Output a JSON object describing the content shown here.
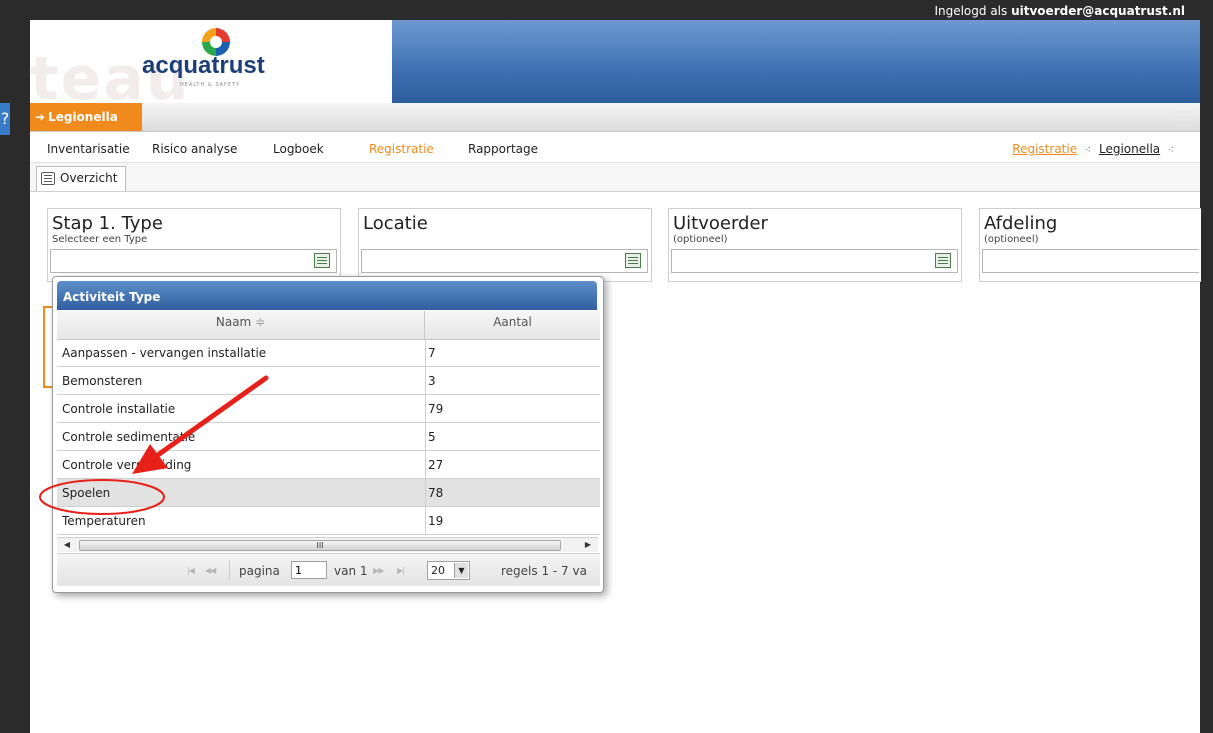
{
  "header": {
    "login_prefix": "Ingelogd als",
    "login_user": "uitvoerder@acquatrust.nl",
    "help_label": "?"
  },
  "logo": {
    "name": "acquatrust",
    "tagline": "HEALTH & SAFETY",
    "watermark": "teau"
  },
  "app": {
    "tab_label": "Legionella"
  },
  "nav": {
    "items": [
      "Inventarisatie",
      "Risico analyse",
      "Logboek",
      "Registratie",
      "Rapportage"
    ],
    "active": "Registratie"
  },
  "breadcrumb": {
    "items": [
      "Registratie",
      "Legionella"
    ]
  },
  "tabs": {
    "overzicht": "Overzicht"
  },
  "panels": [
    {
      "title": "Stap 1. Type",
      "subtitle": "Selecteer een Type",
      "value": ""
    },
    {
      "title": "Locatie",
      "subtitle": "",
      "value": ""
    },
    {
      "title": "Uitvoerder",
      "subtitle": "(optioneel)",
      "value": ""
    },
    {
      "title": "Afdeling",
      "subtitle": "(optioneel)",
      "value": ""
    }
  ],
  "grid": {
    "title": "Activiteit Type",
    "columns": [
      "Naam",
      "Aantal"
    ],
    "sort_indicator": "≑",
    "rows": [
      {
        "name": "Aanpassen - vervangen installatie",
        "count": "7"
      },
      {
        "name": "Bemonsteren",
        "count": "3"
      },
      {
        "name": "Controle installatie",
        "count": "79"
      },
      {
        "name": "Controle sedimentatie",
        "count": "5"
      },
      {
        "name": "Controle verspreiding",
        "count": "27"
      },
      {
        "name": "Spoelen",
        "count": "78"
      },
      {
        "name": "Temperaturen",
        "count": "19"
      }
    ],
    "selected_row": "Spoelen",
    "scroll_thumb": "III",
    "pager": {
      "page_label": "pagina",
      "page_value": "1",
      "of_label": "van 1",
      "page_size": "20",
      "records_label": "regels 1 - 7 va"
    }
  },
  "colors": {
    "accent_orange": "#f08a1c",
    "header_blue": "#3f70b3",
    "grid_title_blue": "#2f5f9f",
    "annotation_red": "#e8201a"
  }
}
